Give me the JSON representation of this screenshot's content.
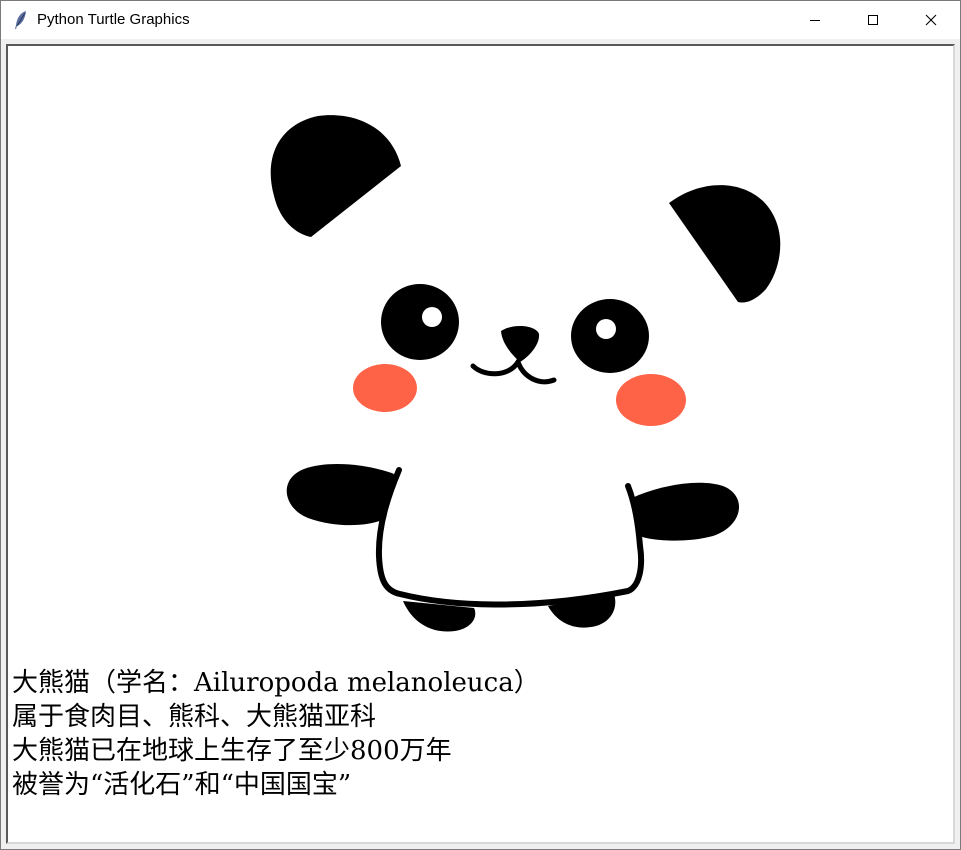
{
  "window": {
    "title": "Python Turtle Graphics",
    "icon": "feather-icon",
    "controls": [
      "minimize-icon",
      "maximize-icon",
      "close-icon"
    ]
  },
  "canvas": {
    "background": "#ffffff",
    "drawing": "panda",
    "colors": {
      "ink": "#000000",
      "blush": "#ff6347",
      "eye_highlight": "#ffffff"
    },
    "text_lines": [
      "大熊猫（学名：Ailuropoda melanoleuca）",
      "属于食肉目、熊科、大熊猫亚科",
      "大熊猫已在地球上生存了至少800万年",
      "被誉为“活化石”和“中国国宝”"
    ]
  }
}
